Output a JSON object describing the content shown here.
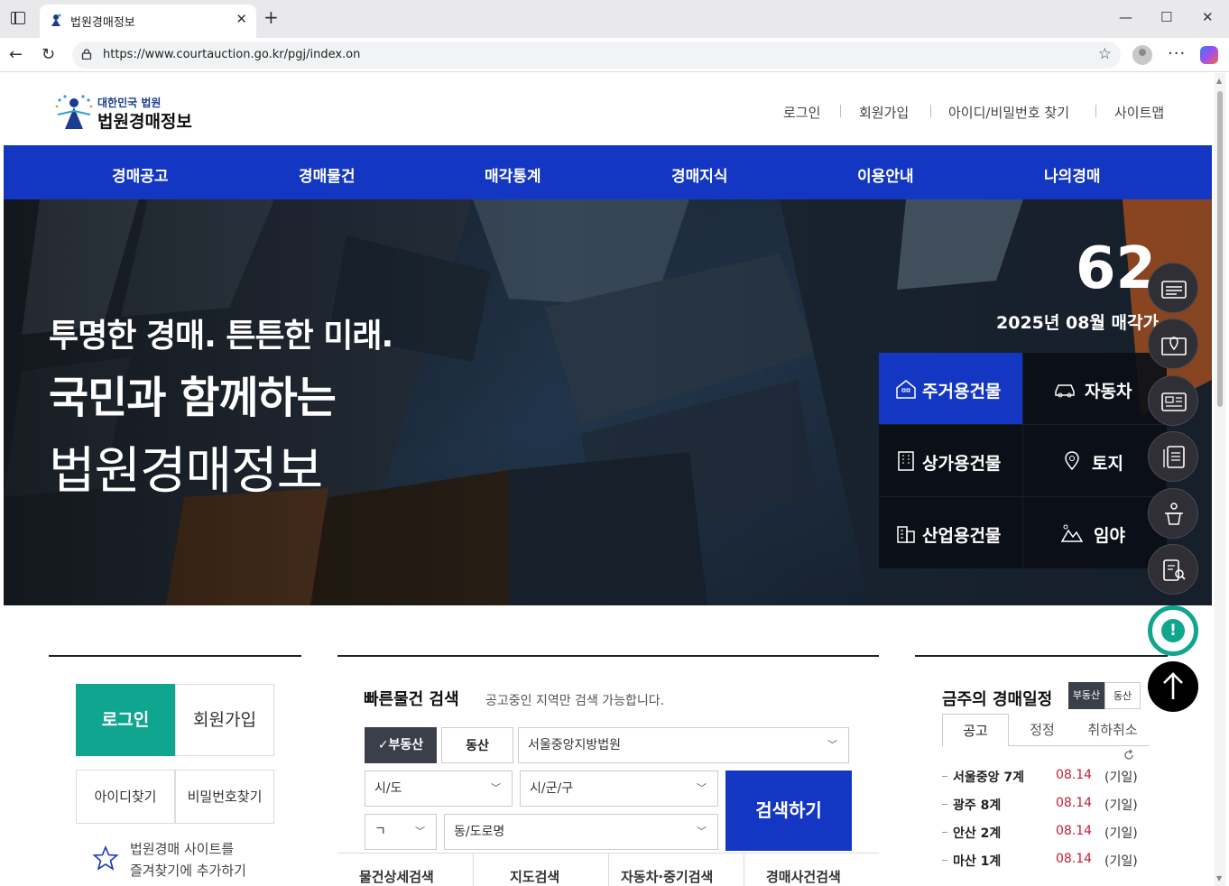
{
  "browser": {
    "tab_title": "법원경매정보",
    "url": "https://www.courtauction.go.kr/pgj/index.on"
  },
  "site": {
    "logo_sub": "대한민국 법원",
    "logo_main": "법원경매정보",
    "util_links": [
      "로그인",
      "회원가입",
      "아이디/비밀번호 찾기",
      "사이트맵"
    ],
    "gnb": [
      "경매공고",
      "경매물건",
      "매각통계",
      "경매지식",
      "이용안내",
      "나의경매"
    ]
  },
  "hero": {
    "line1": "투명한 경매. 튼튼한 미래.",
    "line2": "국민과 함께하는",
    "line3": "법원경매정보",
    "count": "62",
    "count_label": "2025년 08월 매각가",
    "categories": [
      "주거용건물",
      "자동차",
      "상가용건물",
      "토지",
      "산업용건물",
      "임야"
    ]
  },
  "login_panel": {
    "login": "로그인",
    "join": "회원가입",
    "find_id": "아이디찾기",
    "find_pw": "비밀번호찾기",
    "favorite_line1": "법원경매 사이트를",
    "favorite_line2": "즐겨찾기에 추가하기"
  },
  "quick_search": {
    "title": "빠른물건 검색",
    "desc": "공고중인 지역만 검색 가능합니다.",
    "seg_real_estate": "✓부동산",
    "seg_movable": "동산",
    "court": "서울중앙지방법원",
    "sido": "시/도",
    "sigungu": "시/군/구",
    "initial": "ㄱ",
    "dong": "동/도로명",
    "search": "검색하기",
    "sub_tabs": [
      "물건상세검색",
      "지도검색",
      "자동차·중기검색",
      "경매사건검색"
    ]
  },
  "weekly": {
    "title": "금주의 경매일정",
    "seg_real_estate": "부동산",
    "seg_movable": "동산",
    "tabs": [
      "공고",
      "정정",
      "취하취소"
    ],
    "rows": [
      {
        "court": "서울중앙 7계",
        "date": "08.14",
        "status": "(기일)"
      },
      {
        "court": "광주 8계",
        "date": "08.14",
        "status": "(기일)"
      },
      {
        "court": "안산 2계",
        "date": "08.14",
        "status": "(기일)"
      },
      {
        "court": "마산 1계",
        "date": "08.14",
        "status": "(기일)"
      }
    ]
  },
  "colors": {
    "brand_blue": "#1437c3",
    "teal": "#0fa58f",
    "date_red": "#c0203a"
  }
}
